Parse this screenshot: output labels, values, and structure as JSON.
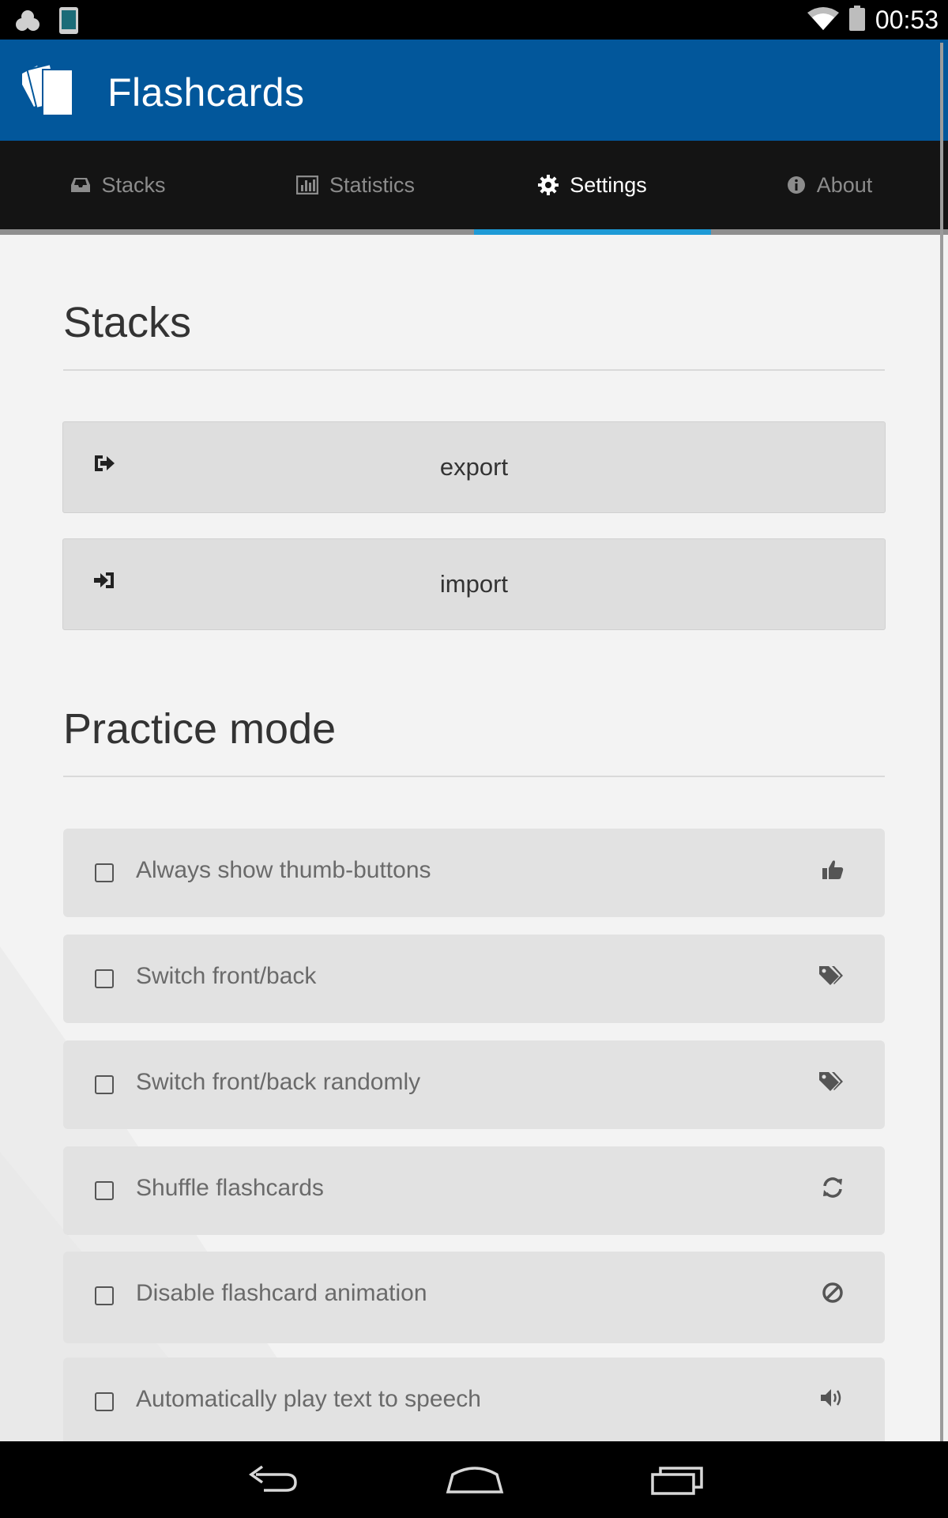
{
  "status_bar": {
    "time": "00:53",
    "left_icons": [
      "cloud-icon",
      "phone-icon"
    ],
    "right_icons": [
      "wifi-icon",
      "battery-icon"
    ]
  },
  "app_header": {
    "title": "Flashcards",
    "background": "#02579b"
  },
  "tabs": [
    {
      "label": "Stacks",
      "icon": "inbox-icon",
      "active": false
    },
    {
      "label": "Statistics",
      "icon": "bar-chart-icon",
      "active": false
    },
    {
      "label": "Settings",
      "icon": "gear-icon",
      "active": true
    },
    {
      "label": "About",
      "icon": "info-icon",
      "active": false
    }
  ],
  "accent_color": "#1e9ad6",
  "sections": {
    "stacks": {
      "title": "Stacks",
      "buttons": [
        {
          "label": "export",
          "icon": "sign-out-icon"
        },
        {
          "label": "import",
          "icon": "sign-in-icon"
        }
      ]
    },
    "practice_mode": {
      "title": "Practice mode",
      "options": [
        {
          "label": "Always show thumb-buttons",
          "icon": "thumbs-up-icon",
          "checked": false
        },
        {
          "label": "Switch front/back",
          "icon": "tags-icon",
          "checked": false
        },
        {
          "label": "Switch front/back randomly",
          "icon": "tags-icon",
          "checked": false
        },
        {
          "label": "Shuffle flashcards",
          "icon": "refresh-icon",
          "checked": false
        },
        {
          "label": "Disable flashcard animation",
          "icon": "ban-icon",
          "checked": false
        },
        {
          "label": "Automatically play text to speech",
          "icon": "volume-up-icon",
          "checked": false
        }
      ]
    }
  },
  "nav_bar": {
    "buttons": [
      "back-icon",
      "home-icon",
      "recent-apps-icon"
    ]
  }
}
